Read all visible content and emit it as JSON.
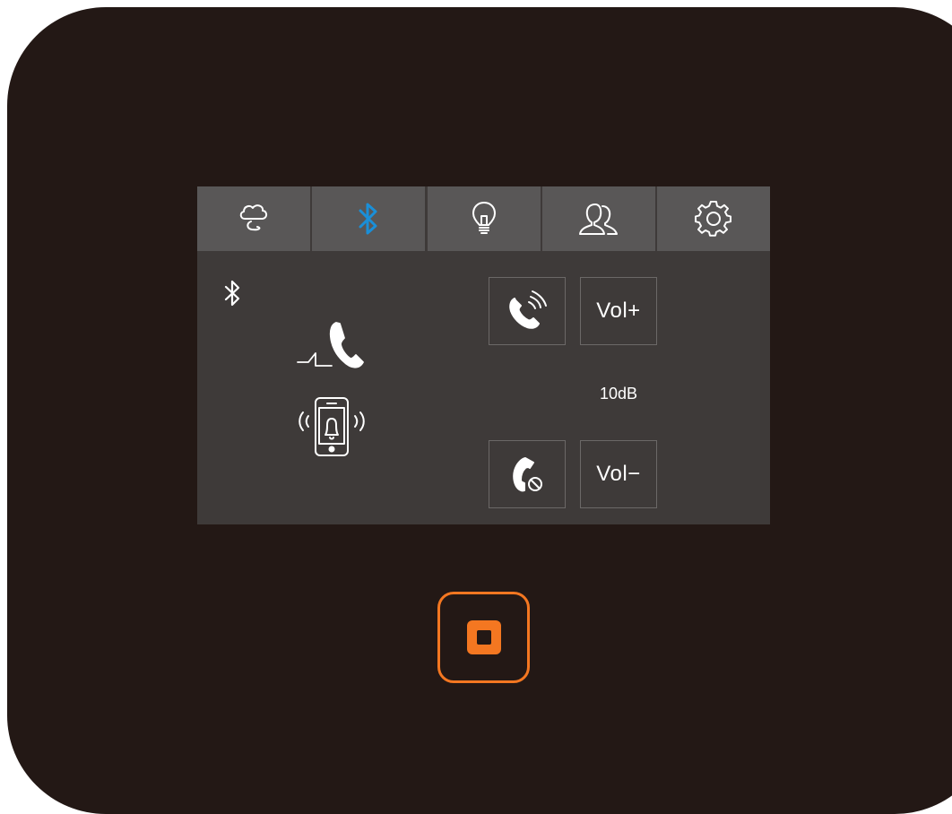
{
  "tabs": [
    {
      "icon": "cloud-icon",
      "active": false
    },
    {
      "icon": "bluetooth-icon",
      "active": true
    },
    {
      "icon": "lightbulb-icon",
      "active": false
    },
    {
      "icon": "contacts-icon",
      "active": false
    },
    {
      "icon": "gear-icon",
      "active": false
    }
  ],
  "status": {
    "bluetooth_icon": "bluetooth-icon",
    "call_icon": "incoming-call-icon",
    "ring_icon": "phone-ringing-icon"
  },
  "controls": {
    "answer_icon": "answer-call-icon",
    "reject_icon": "reject-call-icon",
    "vol_up_label": "Vol+",
    "vol_down_label": "Vol−",
    "volume_value": "10dB"
  },
  "colors": {
    "device_body": "#231815",
    "screen_bg": "#3e3a39",
    "tab_bg": "#595757",
    "active_accent": "#1a8fd8",
    "home_button": "#f47721"
  }
}
